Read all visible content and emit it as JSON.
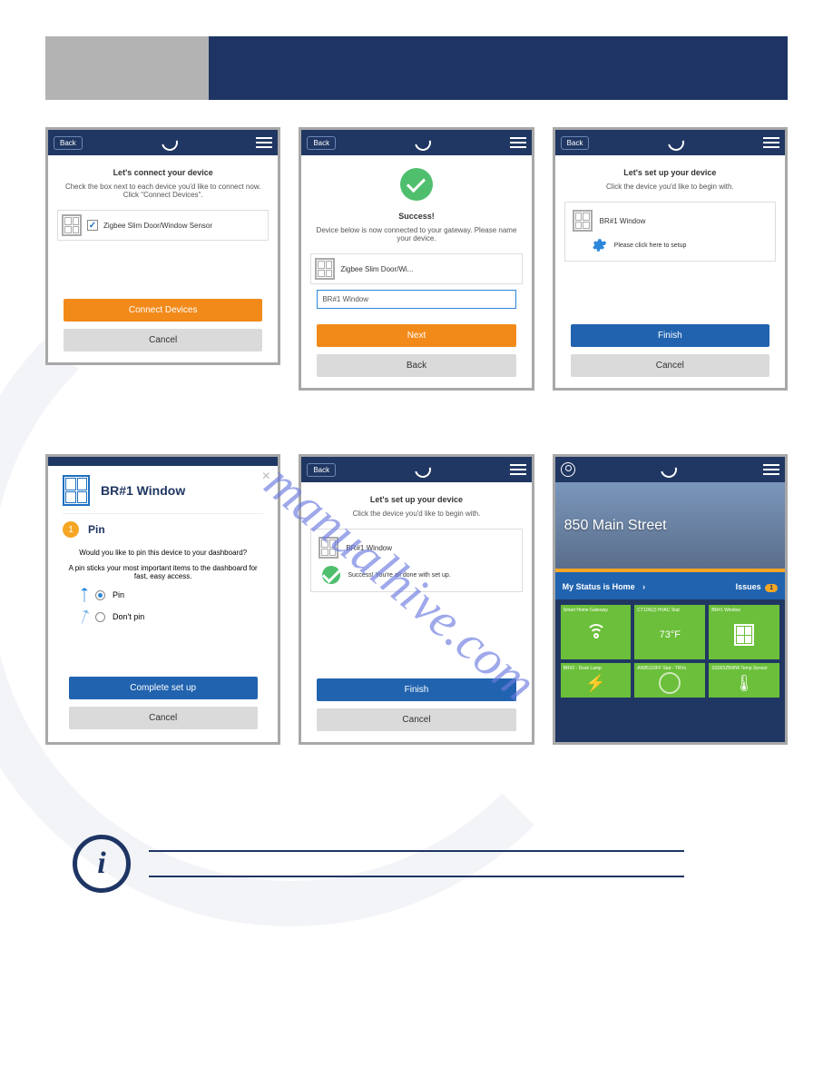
{
  "watermark_text": "manualhive.com",
  "common": {
    "back_label": "Back",
    "menu_aria": "Menu",
    "logo_aria": "App logo"
  },
  "screen1": {
    "title": "Let's connect your device",
    "subtitle": "Check the box next to each device you'd like to connect now. Click \"Connect Devices\".",
    "device_label": "Zigbee Slim Door/Window Sensor",
    "primary_btn": "Connect Devices",
    "secondary_btn": "Cancel"
  },
  "screen2": {
    "success": "Success!",
    "subtitle": "Device below is now connected to your gateway. Please name your device.",
    "device_label": "Zigbee Slim Door/Wi...",
    "input_value": "BR#1 Window",
    "primary_btn": "Next",
    "secondary_btn": "Back"
  },
  "screen3": {
    "title": "Let's set up your device",
    "subtitle": "Click the device you'd like to begin with.",
    "device_label": "BR#1 Window",
    "setup_hint": "Please click here to setup",
    "primary_btn": "Finish",
    "secondary_btn": "Cancel"
  },
  "screen4": {
    "modal_title": "BR#1 Window",
    "step_num": "1",
    "step_title": "Pin",
    "pin_q1": "Would you like to pin this device to your dashboard?",
    "pin_q2": "A pin sticks your most important items to the dashboard for fast, easy access.",
    "opt_pin": "Pin",
    "opt_nopin": "Don't pin",
    "primary_btn": "Complete set up",
    "secondary_btn": "Cancel"
  },
  "screen5": {
    "title": "Let's set up your device",
    "subtitle": "Click the device you'd like to begin with.",
    "device_label": "BR#1 Window",
    "success_msg": "Success! You're all done with set up.",
    "primary_btn": "Finish",
    "secondary_btn": "Cancel"
  },
  "screen6": {
    "address": "850 Main Street",
    "status_text": "My Status is Home",
    "issues_label": "Issues",
    "issues_count": "1",
    "tiles": [
      {
        "label": "Smart Home Gateway",
        "icon": "wifi"
      },
      {
        "label": "CT100(2) HVAC Stat",
        "value": "73°F",
        "icon": "power"
      },
      {
        "label": "BR#1 Window",
        "icon": "window"
      },
      {
        "label": "BR#2 - Desk Lamp",
        "icon": "plug"
      },
      {
        "label": "AN85110FF Stat - TRVs",
        "icon": "power"
      },
      {
        "label": "SS003ZBWW Temp Sensor",
        "icon": "thermo"
      }
    ]
  }
}
